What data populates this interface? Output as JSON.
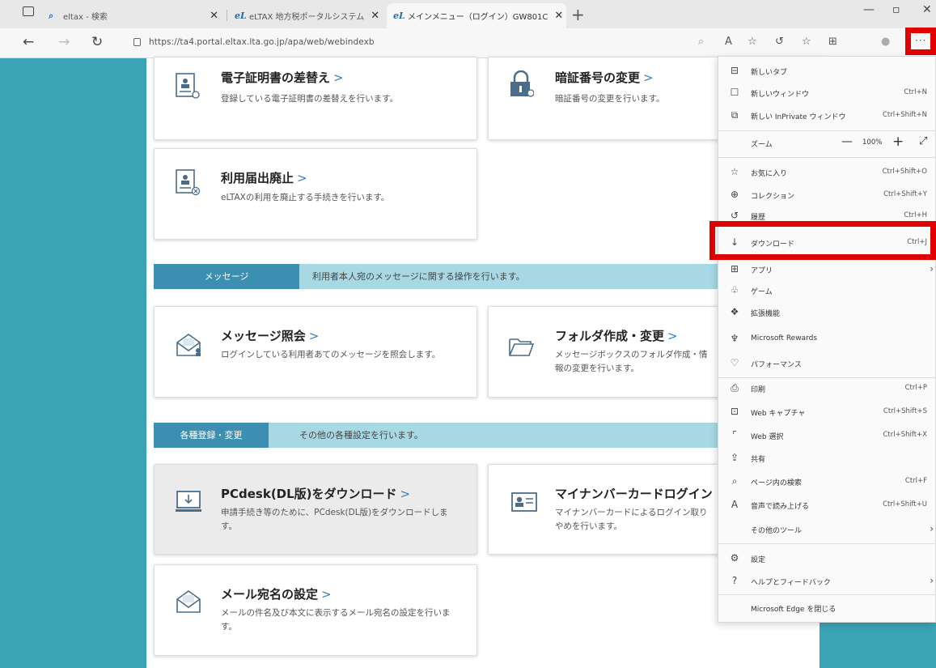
{
  "browser": {
    "tabs": [
      {
        "label": "eltax - 検索"
      },
      {
        "label": "eLTAX 地方税ポータルシステム"
      },
      {
        "label": "メインメニュー（ログイン）GW801C"
      }
    ],
    "url": "https://ta4.portal.eltax.lta.go.jp/apa/web/webindexb",
    "more_label": "···"
  },
  "cards": {
    "cert_title": "電子証明書の差替え",
    "cert_desc": "登録している電子証明書の差替えを行います。",
    "pin_title": "暗証番号の変更",
    "pin_desc": "暗証番号の変更を行います。",
    "abolish_title": "利用届出廃止",
    "abolish_desc": "eLTAXの利用を廃止する手続きを行います。",
    "msg_title": "メッセージ照会",
    "msg_desc": "ログインしている利用者あてのメッセージを照会します。",
    "folder_title": "フォルダ作成・変更",
    "folder_desc": "メッセージボックスのフォルダ作成・情報の変更を行います。",
    "pcdesk_title": "PCdesk(DL版)をダウンロード",
    "pcdesk_desc": "申請手続き等のために、PCdesk(DL版)をダウンロードします。",
    "mynumber_title": "マイナンバーカードログイン",
    "mynumber_desc": "マイナンバーカードによるログイン取りやめを行います。",
    "mail_title": "メール宛名の設定",
    "mail_desc": "メールの件名及び本文に表示するメール宛名の設定を行います。",
    "chevron": ">"
  },
  "sections": {
    "message_label": "メッセージ",
    "message_desc": "利用者本人宛のメッセージに関する操作を行います。",
    "settings_label": "各種登録・変更",
    "settings_desc": "その他の各種設定を行います。"
  },
  "menu": {
    "new_tab": "新しいタブ",
    "new_window": "新しいウィンドウ",
    "new_window_key": "Ctrl+N",
    "inprivate": "新しい InPrivate ウィンドウ",
    "inprivate_key": "Ctrl+Shift+N",
    "zoom": "ズーム",
    "zoom_minus": "—",
    "zoom_value": "100%",
    "zoom_plus": "+",
    "favorites": "お気に入り",
    "favorites_key": "Ctrl+Shift+O",
    "collections": "コレクション",
    "collections_key": "Ctrl+Shift+Y",
    "history": "履歴",
    "history_key": "Ctrl+H",
    "downloads": "ダウンロード",
    "downloads_key": "Ctrl+J",
    "apps": "アプリ",
    "games": "ゲーム",
    "extensions": "拡張機能",
    "rewards": "Microsoft Rewards",
    "performance": "パフォーマンス",
    "print": "印刷",
    "print_key": "Ctrl+P",
    "capture": "Web キャプチャ",
    "capture_key": "Ctrl+Shift+S",
    "select": "Web 選択",
    "select_key": "Ctrl+Shift+X",
    "share": "共有",
    "find": "ページ内の検索",
    "find_key": "Ctrl+F",
    "read_aloud": "音声で読み上げる",
    "read_aloud_key": "Ctrl+Shift+U",
    "more_tools": "その他のツール",
    "settings": "設定",
    "help": "ヘルプとフィードバック",
    "close_edge": "Microsoft Edge を閉じる"
  }
}
